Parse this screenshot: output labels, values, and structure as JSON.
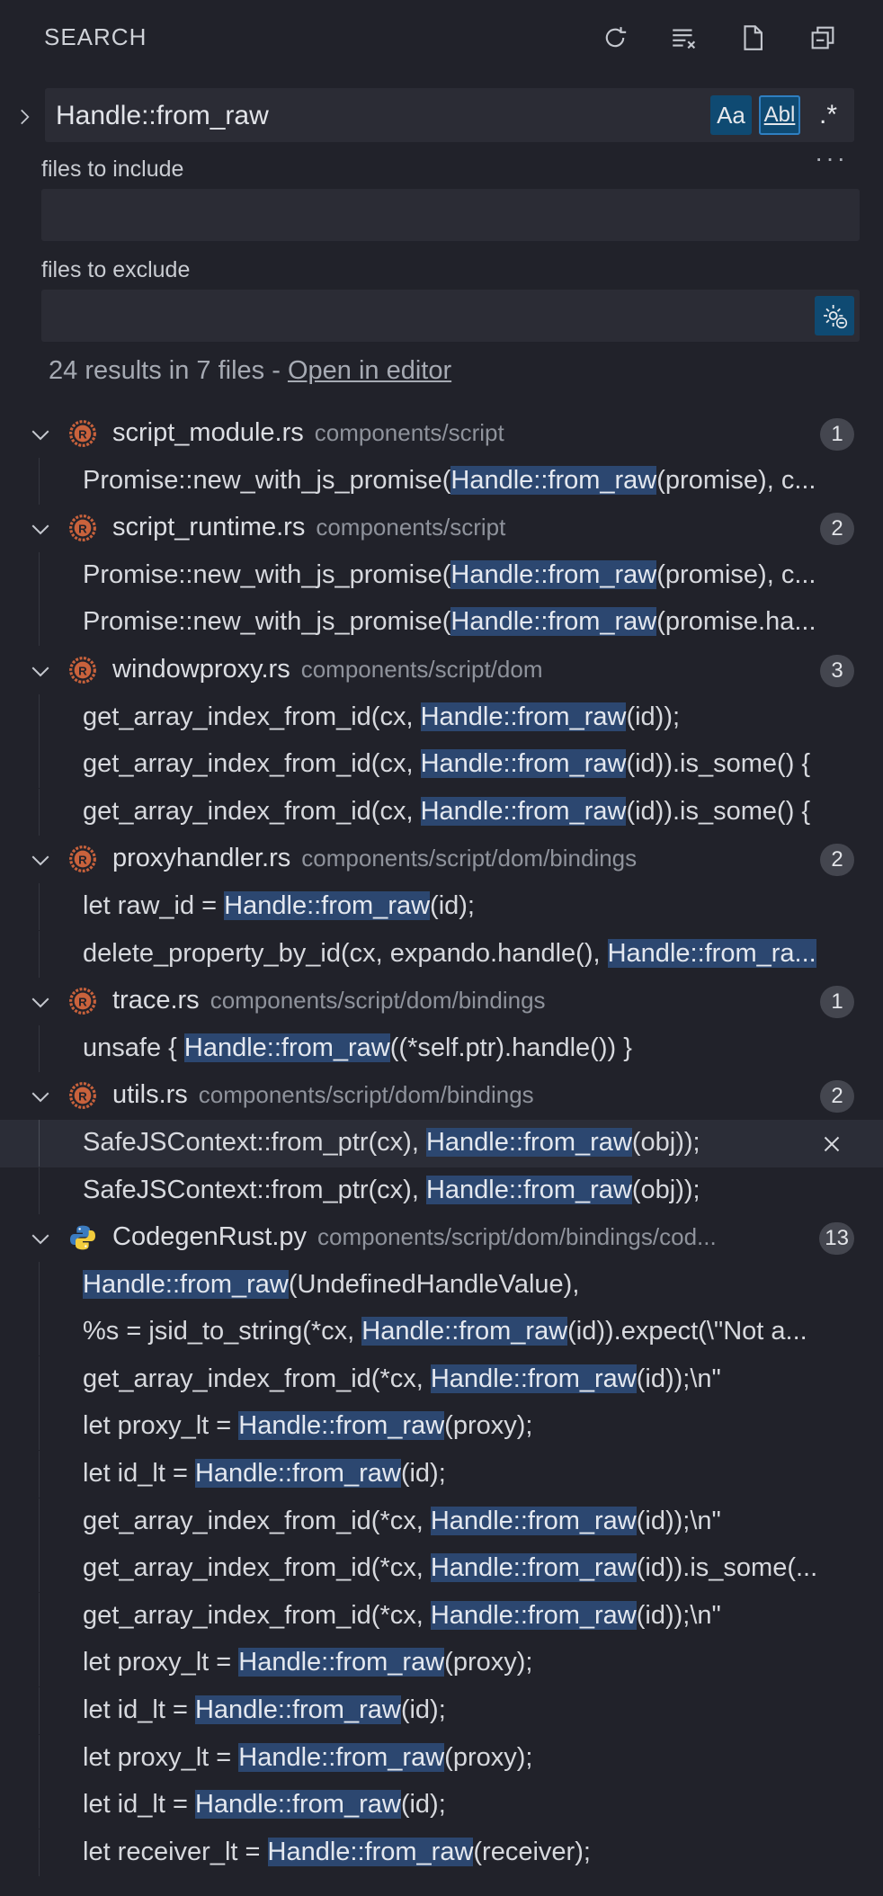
{
  "header": {
    "title": "SEARCH"
  },
  "search": {
    "query": "Handle::from_raw",
    "match_case_label": "Aa",
    "whole_word_label": "Abl",
    "regex_label": ".*",
    "more_label": "···"
  },
  "include": {
    "label": "files to include",
    "value": ""
  },
  "exclude": {
    "label": "files to exclude",
    "value": ""
  },
  "summary": {
    "text": "24 results in 7 files - ",
    "link": "Open in editor"
  },
  "results": [
    {
      "name": "script_module.rs",
      "path": "components/script",
      "count": "1",
      "icon": "rust-file-icon",
      "matches": [
        {
          "pre": "Promise::new_with_js_promise(",
          "hit": "Handle::from_raw",
          "post": "(promise), c..."
        }
      ]
    },
    {
      "name": "script_runtime.rs",
      "path": "components/script",
      "count": "2",
      "icon": "rust-file-icon",
      "matches": [
        {
          "pre": "Promise::new_with_js_promise(",
          "hit": "Handle::from_raw",
          "post": "(promise), c..."
        },
        {
          "pre": "Promise::new_with_js_promise(",
          "hit": "Handle::from_raw",
          "post": "(promise.ha..."
        }
      ]
    },
    {
      "name": "windowproxy.rs",
      "path": "components/script/dom",
      "count": "3",
      "icon": "rust-file-icon",
      "matches": [
        {
          "pre": "get_array_index_from_id(cx, ",
          "hit": "Handle::from_raw",
          "post": "(id));"
        },
        {
          "pre": "get_array_index_from_id(cx, ",
          "hit": "Handle::from_raw",
          "post": "(id)).is_some() {"
        },
        {
          "pre": "get_array_index_from_id(cx, ",
          "hit": "Handle::from_raw",
          "post": "(id)).is_some() {"
        }
      ]
    },
    {
      "name": "proxyhandler.rs",
      "path": "components/script/dom/bindings",
      "count": "2",
      "icon": "rust-file-icon",
      "matches": [
        {
          "pre": "let raw_id = ",
          "hit": "Handle::from_raw",
          "post": "(id);"
        },
        {
          "pre": "delete_property_by_id(cx, expando.handle(), ",
          "hit": "Handle::from_ra...",
          "post": ""
        }
      ]
    },
    {
      "name": "trace.rs",
      "path": "components/script/dom/bindings",
      "count": "1",
      "icon": "rust-file-icon",
      "matches": [
        {
          "pre": "unsafe { ",
          "hit": "Handle::from_raw",
          "post": "((*self.ptr).handle()) }"
        }
      ]
    },
    {
      "name": "utils.rs",
      "path": "components/script/dom/bindings",
      "count": "2",
      "icon": "rust-file-icon",
      "matches": [
        {
          "pre": "SafeJSContext::from_ptr(cx), ",
          "hit": "Handle::from_raw",
          "post": "(obj));",
          "selected": true
        },
        {
          "pre": "SafeJSContext::from_ptr(cx), ",
          "hit": "Handle::from_raw",
          "post": "(obj));"
        }
      ]
    },
    {
      "name": "CodegenRust.py",
      "path": "components/script/dom/bindings/cod...",
      "count": "13",
      "icon": "python-file-icon",
      "matches": [
        {
          "pre": "",
          "hit": "Handle::from_raw",
          "post": "(UndefinedHandleValue),"
        },
        {
          "pre": "%s = jsid_to_string(*cx, ",
          "hit": "Handle::from_raw",
          "post": "(id)).expect(\\\"Not a..."
        },
        {
          "pre": "get_array_index_from_id(*cx, ",
          "hit": "Handle::from_raw",
          "post": "(id));\\n\""
        },
        {
          "pre": "let proxy_lt = ",
          "hit": "Handle::from_raw",
          "post": "(proxy);"
        },
        {
          "pre": "let id_lt = ",
          "hit": "Handle::from_raw",
          "post": "(id);"
        },
        {
          "pre": "get_array_index_from_id(*cx, ",
          "hit": "Handle::from_raw",
          "post": "(id));\\n\""
        },
        {
          "pre": "get_array_index_from_id(*cx, ",
          "hit": "Handle::from_raw",
          "post": "(id)).is_some(..."
        },
        {
          "pre": "get_array_index_from_id(*cx, ",
          "hit": "Handle::from_raw",
          "post": "(id));\\n\""
        },
        {
          "pre": "let proxy_lt = ",
          "hit": "Handle::from_raw",
          "post": "(proxy);"
        },
        {
          "pre": "let id_lt = ",
          "hit": "Handle::from_raw",
          "post": "(id);"
        },
        {
          "pre": "let proxy_lt = ",
          "hit": "Handle::from_raw",
          "post": "(proxy);"
        },
        {
          "pre": "let id_lt = ",
          "hit": "Handle::from_raw",
          "post": "(id);"
        },
        {
          "pre": "let receiver_lt = ",
          "hit": "Handle::from_raw",
          "post": "(receiver);"
        }
      ]
    }
  ],
  "colors": {
    "background": "#21222a",
    "highlight": "#2c4770",
    "active_toggle": "#0f4a72",
    "rust_icon": "#c9623c",
    "python_blue": "#3b7bbf",
    "python_yellow": "#f2cc3c"
  }
}
